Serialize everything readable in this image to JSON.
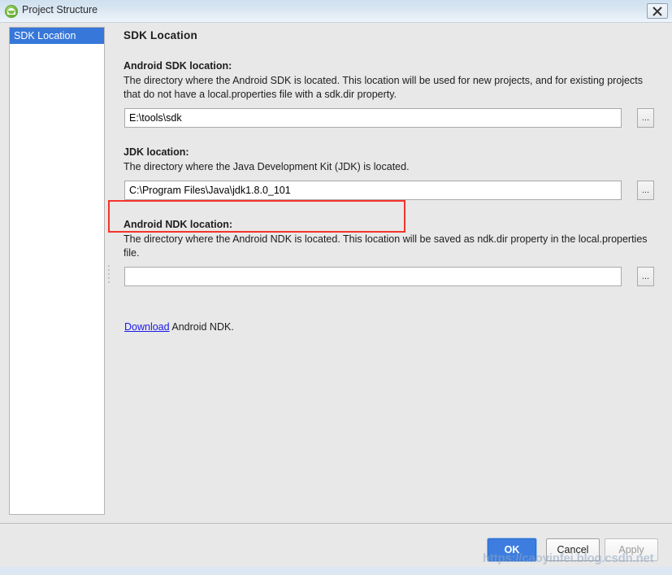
{
  "window": {
    "title": "Project Structure",
    "app_icon": "android-studio-icon",
    "close_label": "close-icon"
  },
  "sidebar": {
    "items": [
      {
        "label": "SDK Location",
        "selected": true
      }
    ]
  },
  "main": {
    "page_title": "SDK Location",
    "sections": [
      {
        "label": "Android SDK location:",
        "description": "The directory where the Android SDK is located. This location will be used for new projects, and for existing projects that do not have a local.properties file with a sdk.dir property.",
        "value": "E:\\tools\\sdk",
        "placeholder": "",
        "browse_label": "..."
      },
      {
        "label": "JDK location:",
        "description": "The directory where the Java Development Kit (JDK) is located.",
        "value": "C:\\Program Files\\Java\\jdk1.8.0_101",
        "placeholder": "",
        "browse_label": "..."
      },
      {
        "label": "Android NDK location:",
        "description": "The directory where the Android NDK is located. This location will be saved as ndk.dir property in the local.properties file.",
        "value": "",
        "placeholder": "",
        "browse_label": "..."
      }
    ],
    "ndk_download_link": "Download",
    "ndk_download_tail": " Android NDK."
  },
  "footer": {
    "ok_label": "OK",
    "cancel_label": "Cancel",
    "apply_label": "Apply"
  },
  "overlay": {
    "watermark": "https://caoyinfei.blog.csdn.net",
    "annotation_color": "#f5342b"
  }
}
